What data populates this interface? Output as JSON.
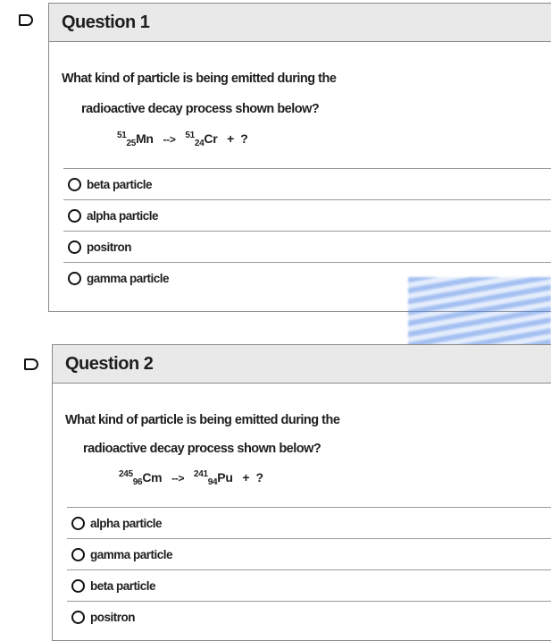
{
  "questions": [
    {
      "title": "Question 1",
      "prompt_line1": "What kind of particle is being emitted during the",
      "prompt_line2": "radioactive decay process shown below?",
      "equation": {
        "reactant_mass": "51",
        "reactant_atomic": "25",
        "reactant_symbol": "Mn",
        "arrow": "-->",
        "product_mass": "51",
        "product_atomic": "24",
        "product_symbol": "Cr",
        "plus": "+",
        "unknown": "?"
      },
      "options": [
        "beta particle",
        "alpha particle",
        "positron",
        "gamma particle"
      ]
    },
    {
      "title": "Question 2",
      "prompt_line1": "What kind of particle is being emitted during the",
      "prompt_line2": "radioactive decay process shown below?",
      "equation": {
        "reactant_mass": "245",
        "reactant_atomic": "96",
        "reactant_symbol": "Cm",
        "arrow": "-->",
        "product_mass": "241",
        "product_atomic": "94",
        "product_symbol": "Pu",
        "plus": "+",
        "unknown": "?"
      },
      "options": [
        "alpha particle",
        "gamma particle",
        "beta particle",
        "positron"
      ]
    }
  ]
}
